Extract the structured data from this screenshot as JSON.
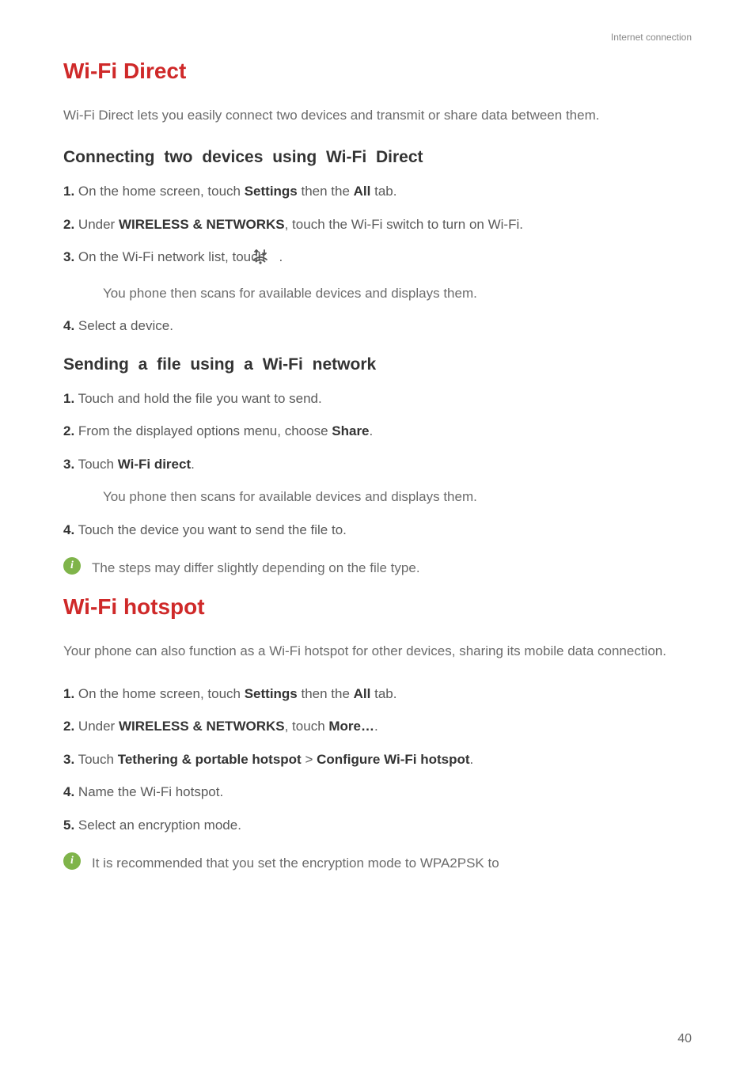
{
  "header": {
    "category": "Internet connection"
  },
  "page_number": "40",
  "section1": {
    "title": "Wi-Fi Direct",
    "intro": "Wi-Fi Direct lets you easily connect two devices and transmit or share data between them.",
    "sub1": {
      "title": "Connecting two devices using Wi-Fi Direct",
      "step1": {
        "n": "1.",
        "pre": " On the home screen, touch ",
        "b1": "Settings",
        "mid": " then the ",
        "b2": "All",
        "post": " tab."
      },
      "step2": {
        "n": "2.",
        "pre": " Under ",
        "b1": "WIRELESS & NETWORKS",
        "post": ", touch the Wi-Fi switch to turn on Wi-Fi."
      },
      "step3": {
        "n": "3.",
        "text": " On the Wi-Fi network list, touch ",
        "post": " .",
        "sub": "You phone then scans for available devices and displays them."
      },
      "step4": {
        "n": "4.",
        "text": " Select a device."
      }
    },
    "sub2": {
      "title": "Sending a file using a Wi-Fi network",
      "step1": {
        "n": "1.",
        "text": " Touch and hold the file you want to send."
      },
      "step2": {
        "n": "2.",
        "pre": " From the displayed options menu, choose ",
        "b1": "Share",
        "post": "."
      },
      "step3": {
        "n": "3.",
        "pre": " Touch ",
        "b1": "Wi-Fi direct",
        "post": ".",
        "sub": "You phone then scans for available devices and displays them."
      },
      "step4": {
        "n": "4.",
        "text": " Touch the device you want to send the file to."
      },
      "note": "The steps may differ slightly depending on the file type."
    }
  },
  "section2": {
    "title": "Wi-Fi hotspot",
    "intro": "Your phone can also function as a Wi-Fi hotspot for other devices, sharing its mobile data connection.",
    "step1": {
      "n": "1.",
      "pre": " On the home screen, touch ",
      "b1": "Settings",
      "mid": " then the ",
      "b2": "All",
      "post": " tab."
    },
    "step2": {
      "n": "2.",
      "pre": " Under ",
      "b1": "WIRELESS & NETWORKS",
      "mid": ", touch ",
      "b2": "More…",
      "post": "."
    },
    "step3": {
      "n": "3.",
      "pre": " Touch ",
      "b1": "Tethering & portable hotspot",
      "mid": " > ",
      "b2": "Configure Wi-Fi hotspot",
      "post": "."
    },
    "step4": {
      "n": "4.",
      "text": " Name the Wi-Fi hotspot."
    },
    "step5": {
      "n": "5.",
      "text": " Select an encryption mode."
    },
    "note": "It is recommended that you set the encryption mode to WPA2PSK to"
  }
}
